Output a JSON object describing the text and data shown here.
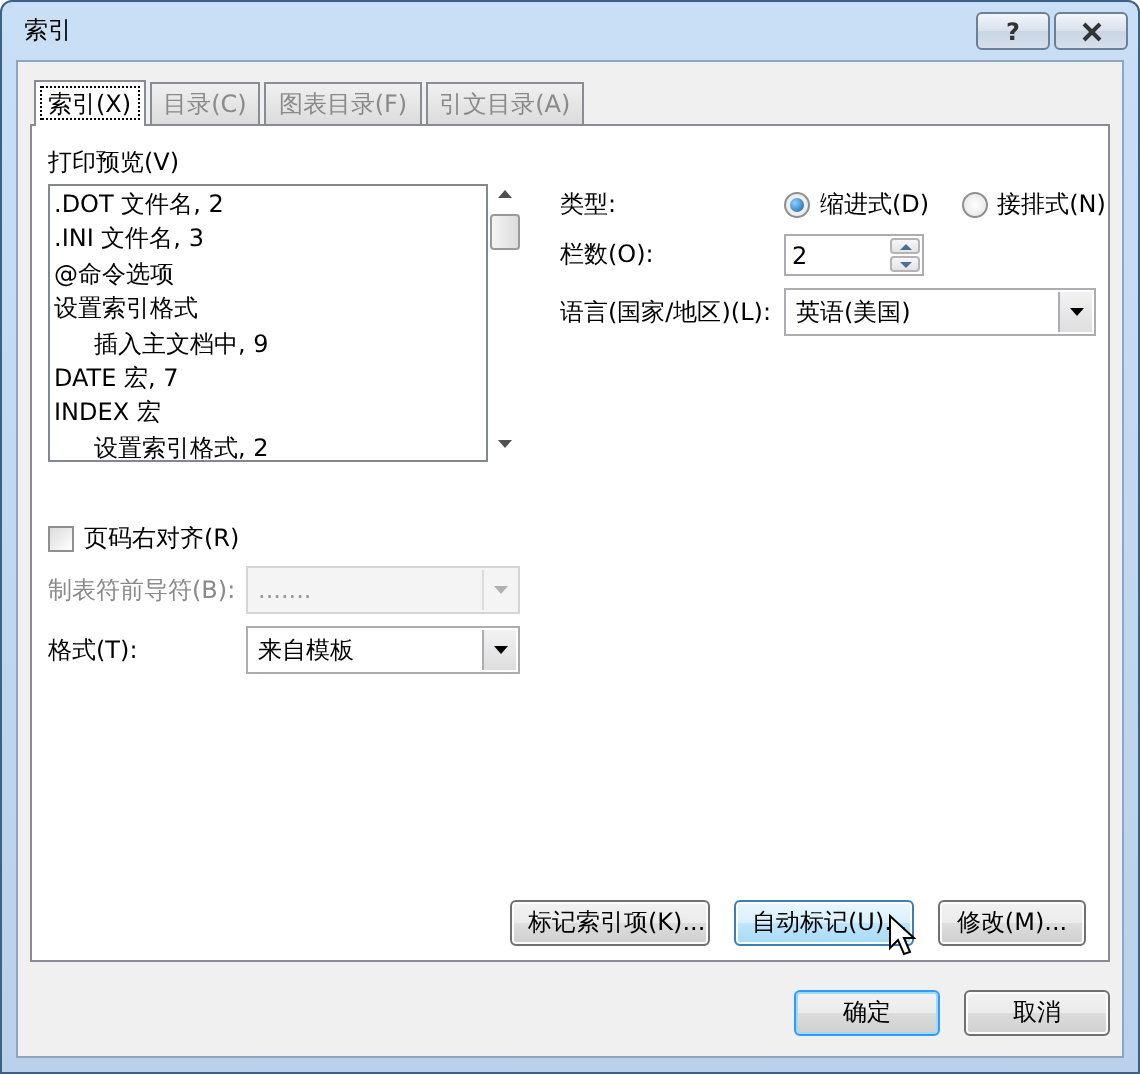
{
  "window": {
    "title": "索引",
    "help_button": "?"
  },
  "tabs": [
    {
      "label": "索引(X)",
      "selected": true
    },
    {
      "label": "目录(C)",
      "selected": false
    },
    {
      "label": "图表目录(F)",
      "selected": false
    },
    {
      "label": "引文目录(A)",
      "selected": false
    }
  ],
  "print_preview": {
    "label": "打印预览(V)",
    "entries": [
      {
        "text": ".DOT 文件名, 2"
      },
      {
        "text": ".INI 文件名, 3"
      },
      {
        "text": "@命令选项"
      },
      {
        "text": "设置索引格式",
        "children": [
          {
            "text": "插入主文档中, 9"
          }
        ]
      },
      {
        "text": "DATE 宏, 7"
      },
      {
        "text": "INDEX 宏",
        "children": [
          {
            "text": "设置索引格式, 2"
          }
        ]
      }
    ]
  },
  "type": {
    "label": "类型:",
    "options": [
      {
        "label": "缩进式(D)",
        "selected": true
      },
      {
        "label": "接排式(N)",
        "selected": false
      }
    ]
  },
  "columns": {
    "label": "栏数(O):",
    "value": "2"
  },
  "language": {
    "label": "语言(国家/地区)(L):",
    "value": "英语(美国)",
    "disabled": false
  },
  "right_align_page_numbers": {
    "label": "页码右对齐(R)",
    "checked": false
  },
  "tab_leader": {
    "label": "制表符前导符(B):",
    "value": ".......",
    "disabled": true
  },
  "formats": {
    "label": "格式(T):",
    "value": "来自模板",
    "disabled": false
  },
  "actions": [
    {
      "label": "标记索引项(K)...",
      "hovered": false
    },
    {
      "label": "自动标记(U)...",
      "hovered": true
    },
    {
      "label": "修改(M)...",
      "hovered": false
    }
  ],
  "dialog_buttons": [
    {
      "label": "确定",
      "default": true
    },
    {
      "label": "取消",
      "default": false
    }
  ]
}
